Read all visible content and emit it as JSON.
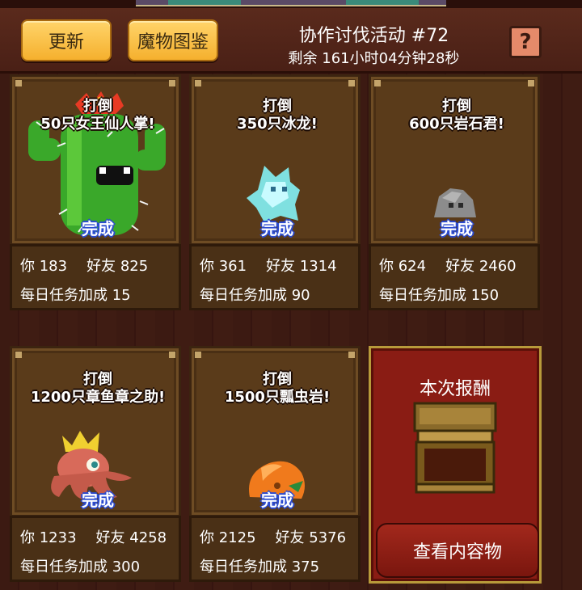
{
  "header": {
    "refresh_label": "更新",
    "monster_book_label": "魔物图鉴",
    "event_title": "协作讨伐活动 #72",
    "event_timer": "剩余 161小时04分钟28秒",
    "help_glyph": "?"
  },
  "quests": [
    {
      "line1": "打倒",
      "line2": "50只女王仙人掌!",
      "status": "完成",
      "you_label": "你",
      "you_value": "183",
      "friend_label": "好友",
      "friend_value": "825",
      "bonus_label": "每日任务加成",
      "bonus_value": "15",
      "monster_icon": "queen-cactus-icon"
    },
    {
      "line1": "打倒",
      "line2": "350只冰龙!",
      "status": "完成",
      "you_label": "你",
      "you_value": "361",
      "friend_label": "好友",
      "friend_value": "1314",
      "bonus_label": "每日任务加成",
      "bonus_value": "90",
      "monster_icon": "ice-dragon-icon"
    },
    {
      "line1": "打倒",
      "line2": "600只岩石君!",
      "status": "完成",
      "you_label": "你",
      "you_value": "624",
      "friend_label": "好友",
      "friend_value": "2460",
      "bonus_label": "每日任务加成",
      "bonus_value": "150",
      "monster_icon": "rock-golem-icon"
    },
    {
      "line1": "打倒",
      "line2": "1200只章鱼章之助!",
      "status": "完成",
      "you_label": "你",
      "you_value": "1233",
      "friend_label": "好友",
      "friend_value": "4258",
      "bonus_label": "每日任务加成",
      "bonus_value": "300",
      "monster_icon": "octopus-king-icon"
    },
    {
      "line1": "打倒",
      "line2": "1500只瓢虫岩!",
      "status": "完成",
      "you_label": "你",
      "you_value": "2125",
      "friend_label": "好友",
      "friend_value": "5376",
      "bonus_label": "每日任务加成",
      "bonus_value": "375",
      "monster_icon": "ladybug-rock-icon"
    }
  ],
  "reward": {
    "title": "本次报酬",
    "view_button": "查看内容物",
    "icon": "treasure-chest-icon"
  }
}
